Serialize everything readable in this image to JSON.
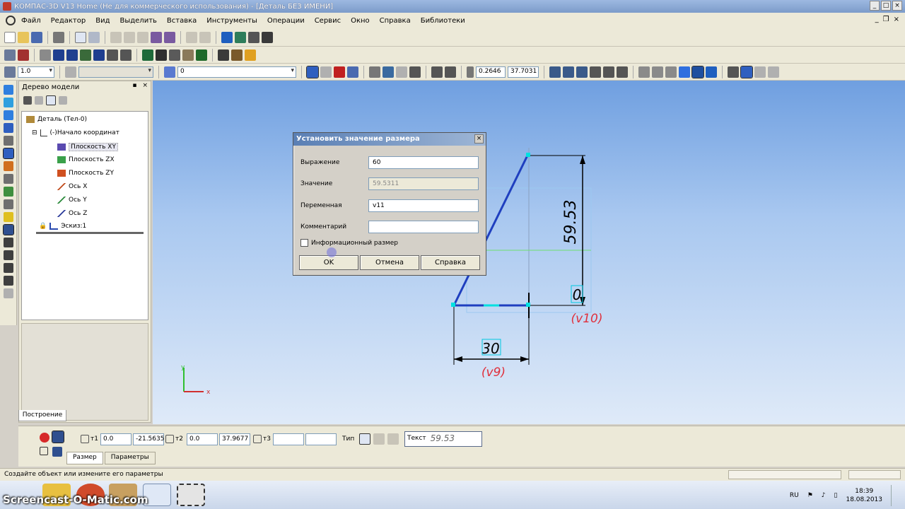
{
  "window": {
    "title": "КОМПАС-3D V13 Home (Не для коммерческого использования) - [Деталь БЕЗ ИМЕНИ]"
  },
  "menu": {
    "items": [
      "Файл",
      "Редактор",
      "Вид",
      "Выделить",
      "Вставка",
      "Инструменты",
      "Операции",
      "Сервис",
      "Окно",
      "Справка",
      "Библиотеки"
    ]
  },
  "toolbar": {
    "scale_value": "1.0",
    "layer_value": "0",
    "coord_x": "0.2646",
    "coord_y": "37.7031"
  },
  "tree": {
    "title": "Дерево модели",
    "root": "Деталь (Тел-0)",
    "items": [
      {
        "label": "(-)Начало координат"
      },
      {
        "label": "Плоскость XY"
      },
      {
        "label": "Плоскость ZX"
      },
      {
        "label": "Плоскость ZY"
      },
      {
        "label": "Ось X"
      },
      {
        "label": "Ось Y"
      },
      {
        "label": "Ось Z"
      },
      {
        "label": "Эскиз:1"
      }
    ],
    "build_tab": "Построение"
  },
  "dialog": {
    "title": "Установить значение размера",
    "expression_label": "Выражение",
    "expression_value": "60",
    "value_label": "Значение",
    "value_value": "59.5311",
    "variable_label": "Переменная",
    "variable_value": "v11",
    "comment_label": "Комментарий",
    "comment_value": "",
    "info_checkbox_label": "Информационный размер",
    "ok_label": "OK",
    "cancel_label": "Отмена",
    "help_label": "Справка"
  },
  "drawing": {
    "dim_vertical": "59.53",
    "dim_bottom": "30",
    "dim_small": "0",
    "var_v9": "(v9)",
    "var_v10": "(v10)",
    "axis_x": "x",
    "axis_y": "y",
    "colors": {
      "sketch_line": "#1f3fbf",
      "dimension": "#000000",
      "variable": "#e0303c",
      "point": "#00e0e0"
    }
  },
  "properties": {
    "t1_label": "т1",
    "t1_x": "0.0",
    "t1_y": "-21.5635",
    "t2_label": "т2",
    "t2_x": "0.0",
    "t2_y": "37.9677",
    "t3_label": "т3",
    "t3_x": "",
    "t3_y": "",
    "type_label": "Тип",
    "text_label": "Текст",
    "text_value": "59.53",
    "tabs": [
      "Размер",
      "Параметры"
    ]
  },
  "status": {
    "message": "Создайте объект или измените его параметры"
  },
  "taskbar": {
    "watermark": "Screencast-O-Matic.com",
    "lang": "RU",
    "time": "18:39",
    "date": "18.08.2013"
  }
}
